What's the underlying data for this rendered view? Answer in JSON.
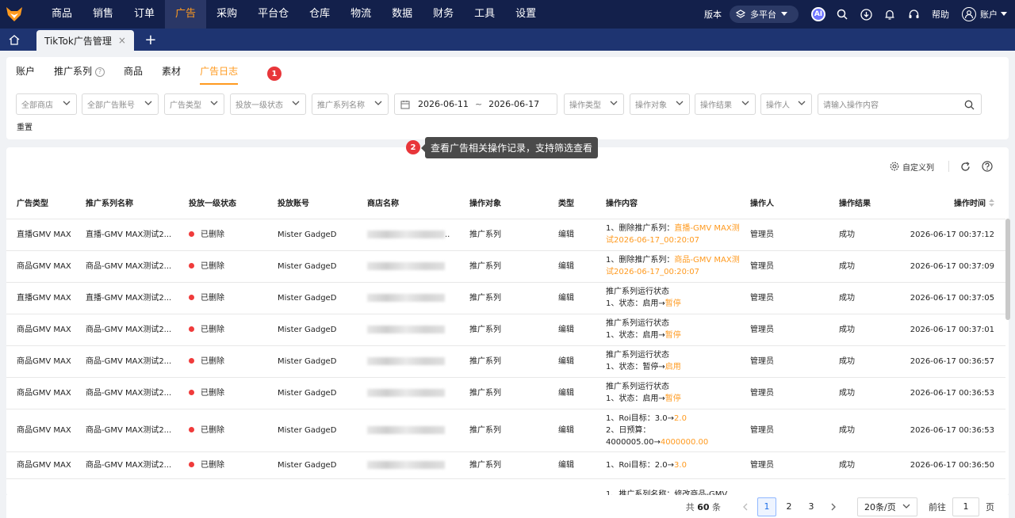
{
  "topnav": {
    "menu": [
      "商品",
      "销售",
      "订单",
      "广告",
      "采购",
      "平台仓",
      "仓库",
      "物流",
      "数据",
      "财务",
      "工具",
      "设置"
    ],
    "active": "广告",
    "version_label": "版本",
    "platform_label": "多平台",
    "ai_label": "AI",
    "help_label": "帮助",
    "account_label": "账户"
  },
  "tabbar": {
    "tab_label": "TikTok广告管理",
    "close_glyph": "×",
    "add_glyph": "+"
  },
  "subtabs": [
    "账户",
    "推广系列",
    "商品",
    "素材",
    "广告日志"
  ],
  "subtab_help_glyph": "?",
  "step1_badge": "1",
  "step2_badge": "2",
  "tooltip_text": "查看广告相关操作记录，支持筛选查看",
  "filters": {
    "shop": "全部商店",
    "ad_account": "全部广告账号",
    "ad_type": "广告类型",
    "status": "投放一级状态",
    "series_name": "推广系列名称",
    "date_start": "2026-06-11",
    "date_sep": "~",
    "date_end": "2026-06-17",
    "op_type": "操作类型",
    "op_target": "操作对象",
    "op_result": "操作结果",
    "operator": "操作人",
    "search_placeholder": "请输入操作内容",
    "reset": "重置"
  },
  "toolbar": {
    "custom_columns": "自定义列"
  },
  "table": {
    "headers": [
      "广告类型",
      "推广系列名称",
      "投放一级状态",
      "投放账号",
      "商店名称",
      "操作对象",
      "类型",
      "操作内容",
      "操作人",
      "操作结果",
      "操作时间"
    ],
    "rows": [
      {
        "ad_type": "直播GMV MAX",
        "series": "直播-GMV MAX测试2...",
        "status": "已删除",
        "account": "Mister GadgeD",
        "shop_tail": "..",
        "target": "推广系列",
        "type": "编辑",
        "content": [
          {
            "t": "1、删除推广系列：",
            "h": "直播-GMV MAX测试2026-06-17_00:20:07"
          }
        ],
        "operator": "管理员",
        "result": "成功",
        "time": "2026-06-17 00:37:12"
      },
      {
        "ad_type": "商品GMV MAX",
        "series": "商品-GMV MAX测试2...",
        "status": "已删除",
        "account": "Mister GadgeD",
        "shop_tail": "",
        "target": "推广系列",
        "type": "编辑",
        "content": [
          {
            "t": "1、删除推广系列：",
            "h": "商品-GMV MAX测试2026-06-17_00:20:07"
          }
        ],
        "operator": "管理员",
        "result": "成功",
        "time": "2026-06-17 00:37:09"
      },
      {
        "ad_type": "直播GMV MAX",
        "series": "直播-GMV MAX测试2...",
        "status": "已删除",
        "account": "Mister GadgeD",
        "shop_tail": "",
        "target": "推广系列",
        "type": "编辑",
        "content": [
          {
            "t": "推广系列运行状态",
            "h": ""
          },
          {
            "t": "1、状态：启用→",
            "h": "暂停"
          }
        ],
        "operator": "管理员",
        "result": "成功",
        "time": "2026-06-17 00:37:05"
      },
      {
        "ad_type": "商品GMV MAX",
        "series": "商品-GMV MAX测试2...",
        "status": "已删除",
        "account": "Mister GadgeD",
        "shop_tail": "",
        "target": "推广系列",
        "type": "编辑",
        "content": [
          {
            "t": "推广系列运行状态",
            "h": ""
          },
          {
            "t": "1、状态：启用→",
            "h": "暂停"
          }
        ],
        "operator": "管理员",
        "result": "成功",
        "time": "2026-06-17 00:37:01"
      },
      {
        "ad_type": "商品GMV MAX",
        "series": "商品-GMV MAX测试2...",
        "status": "已删除",
        "account": "Mister GadgeD",
        "shop_tail": "",
        "target": "推广系列",
        "type": "编辑",
        "content": [
          {
            "t": "推广系列运行状态",
            "h": ""
          },
          {
            "t": "1、状态：暂停→",
            "h": "启用"
          }
        ],
        "operator": "管理员",
        "result": "成功",
        "time": "2026-06-17 00:36:57"
      },
      {
        "ad_type": "商品GMV MAX",
        "series": "商品-GMV MAX测试2...",
        "status": "已删除",
        "account": "Mister GadgeD",
        "shop_tail": "",
        "target": "推广系列",
        "type": "编辑",
        "content": [
          {
            "t": "推广系列运行状态",
            "h": ""
          },
          {
            "t": "1、状态：启用→",
            "h": "暂停"
          }
        ],
        "operator": "管理员",
        "result": "成功",
        "time": "2026-06-17 00:36:53"
      },
      {
        "ad_type": "商品GMV MAX",
        "series": "商品-GMV MAX测试2...",
        "status": "已删除",
        "account": "Mister GadgeD",
        "shop_tail": "",
        "target": "推广系列",
        "type": "编辑",
        "content": [
          {
            "t": "1、Roi目标：3.0→",
            "h": "2.0"
          },
          {
            "t": "2、日预算：",
            "h": ""
          },
          {
            "t": "4000005.00→",
            "h": "4000000.00"
          }
        ],
        "operator": "管理员",
        "result": "成功",
        "time": "2026-06-17 00:36:53"
      },
      {
        "ad_type": "商品GMV MAX",
        "series": "商品-GMV MAX测试2...",
        "status": "已删除",
        "account": "Mister GadgeD",
        "shop_tail": "",
        "target": "推广系列",
        "type": "编辑",
        "content": [
          {
            "t": "1、Roi目标：2.0→",
            "h": "3.0"
          }
        ],
        "operator": "管理员",
        "result": "成功",
        "time": "2026-06-17 00:36:50"
      },
      {
        "ad_type": "",
        "series": "",
        "status": "",
        "account": "",
        "shop_tail": "",
        "target": "",
        "type": "",
        "content": [
          {
            "t": "1、推广系列名称：修改商品-GMV",
            "h": ""
          }
        ],
        "operator": "",
        "result": "",
        "time": ""
      }
    ]
  },
  "pagination": {
    "total_prefix": "共",
    "total": "60",
    "total_suffix": "条",
    "pages": [
      "1",
      "2",
      "3"
    ],
    "current": "1",
    "page_size": "20条/页",
    "goto_prefix": "前往",
    "goto_value": "1",
    "goto_suffix": "页"
  },
  "colors": {
    "nav_bg": "#13204b",
    "tab_bg": "#1e3471",
    "accent": "#ff9a1f",
    "deleted_dot": "#f03b3b"
  }
}
